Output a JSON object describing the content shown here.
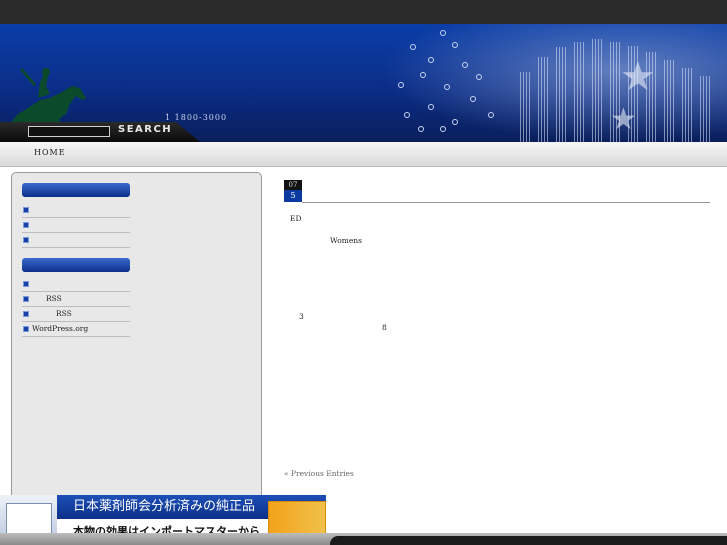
{
  "header": {
    "phone": "1  1800-3000",
    "search": {
      "value": "",
      "button_label": "SEARCH"
    }
  },
  "nav": {
    "items": [
      {
        "label": "HOME"
      }
    ]
  },
  "sidebar": {
    "widget1": {
      "items": [
        {
          "label": ""
        },
        {
          "label": ""
        },
        {
          "label": ""
        }
      ]
    },
    "widget2": {
      "items": [
        {
          "label": ""
        },
        {
          "label": "RSS"
        },
        {
          "label": "RSS"
        },
        {
          "label": "WordPress.org"
        }
      ]
    }
  },
  "post": {
    "date_month": "07",
    "date_day": "5",
    "lines": [
      "ED",
      "Womens",
      "3",
      "8"
    ]
  },
  "pagination": {
    "previous_label": "« Previous Entries"
  },
  "ad": {
    "headline": "日本薬剤師会分析済みの純正品",
    "subline": "本物の効果はインポートマスターから"
  },
  "colors": {
    "banner": "#0b3ea8",
    "accent_blue": "#0c3aa0",
    "sidebar_bg": "#e8e8e8"
  }
}
